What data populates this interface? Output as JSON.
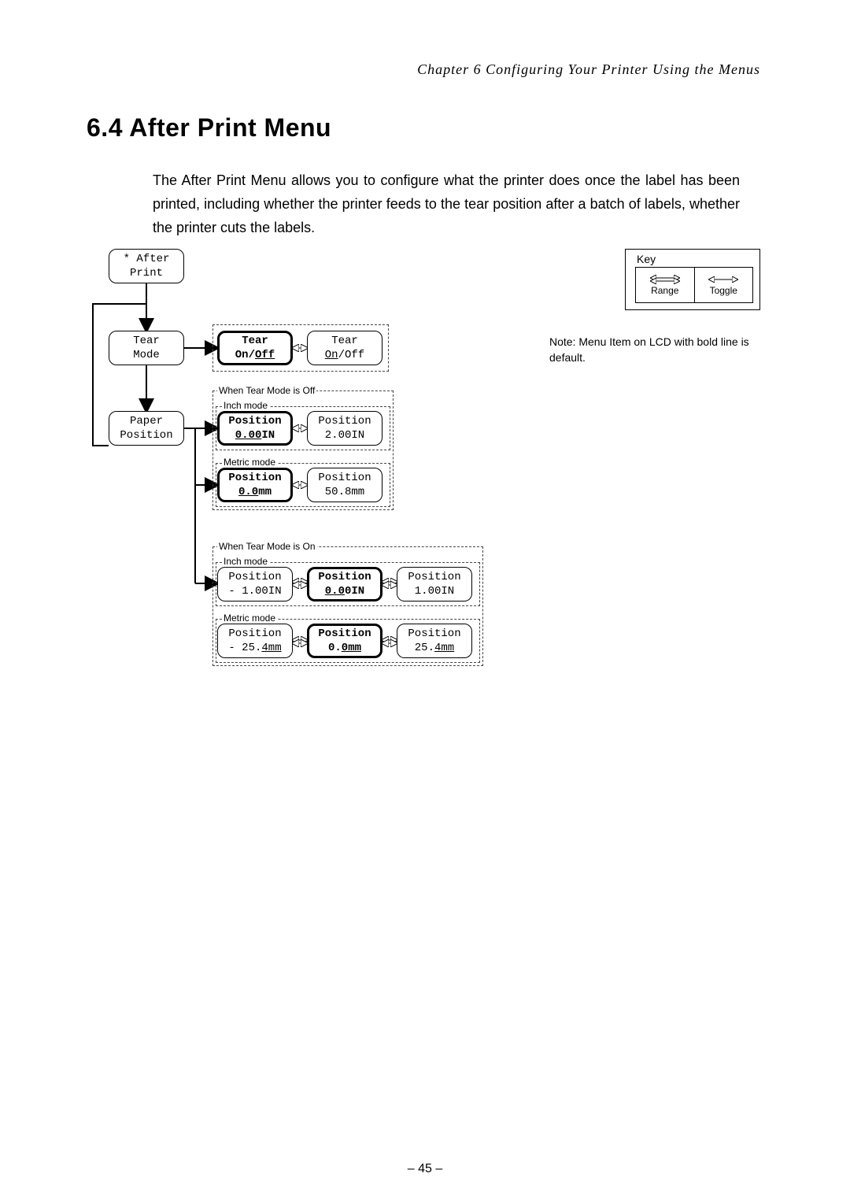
{
  "page": {
    "chapter_line": "Chapter 6   Configuring Your Printer Using the Menus",
    "section_title": "6.4   After Print Menu",
    "body_text": "The After Print Menu allows you to configure what the printer does once the label has been printed, including whether the printer feeds to the tear position after a batch of labels, whether the printer cuts the labels.",
    "footer": "– 45 –"
  },
  "key_legend": {
    "title": "Key",
    "range": "Range",
    "toggle": "Toggle"
  },
  "note": "Note: Menu Item on LCD with bold line is default.",
  "diagram": {
    "root": {
      "line1": "* After",
      "line2": "Print"
    },
    "tear_mode": {
      "line1": "Tear",
      "line2": "Mode"
    },
    "paper_position": {
      "line1": "Paper",
      "line2": "Position"
    },
    "tear_default": {
      "line1": "Tear",
      "l2a": "On/",
      "l2b": "Off"
    },
    "tear_alt": {
      "line1": "Tear",
      "l2a": "On",
      "l2b": "/Off"
    },
    "captions": {
      "off": "When Tear Mode is Off",
      "on": "When Tear Mode is On",
      "inch": "Inch mode",
      "metric": "Metric mode"
    },
    "off_inch_a": {
      "line1": "Position",
      "l2a": "0.00",
      "l2b": "IN"
    },
    "off_inch_b": {
      "line1": "Position",
      "line2": "2.00IN"
    },
    "off_metric_a": {
      "line1": "Position",
      "l2a": "0.0",
      "l2b": "mm"
    },
    "off_metric_b": {
      "line1": "Position",
      "line2": "50.8mm"
    },
    "on_inch_a": {
      "line1": "Position",
      "line2": "- 1.00IN"
    },
    "on_inch_b": {
      "line1": "Position",
      "l2a": "0.0",
      "l2b": "0IN"
    },
    "on_inch_c": {
      "line1": "Position",
      "line2": "1.00IN"
    },
    "on_metric_a": {
      "line1": "Position",
      "l2a": "- 25.",
      "l2b": "4mm"
    },
    "on_metric_b": {
      "line1": "Position",
      "l2a": "0.",
      "l2b": "0mm"
    },
    "on_metric_c": {
      "line1": "Position",
      "l2a": "25.",
      "l2b": "4mm"
    }
  }
}
